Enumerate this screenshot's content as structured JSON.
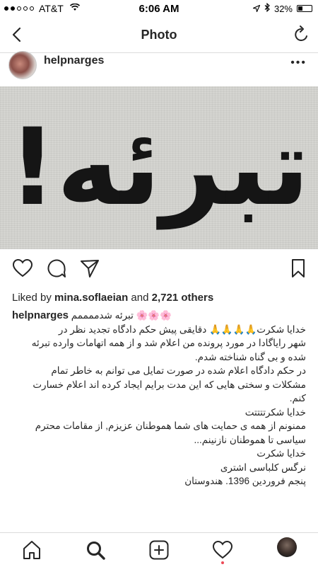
{
  "status_bar": {
    "carrier": "AT&T",
    "time": "6:06 AM",
    "battery": "32%",
    "battery_level": 0.32,
    "signal_bars_filled": 2,
    "signal_bars_total": 5
  },
  "nav": {
    "title": "Photo",
    "back_icon": "chevron-left-icon",
    "refresh_icon": "refresh-icon"
  },
  "post": {
    "username": "helpnarges",
    "more_label": "•••",
    "photo_text": "تبرئه!",
    "likes_prefix": "Liked by",
    "likes_user": "mina.soflaeian",
    "likes_and": "and",
    "likes_count": "2,721 others"
  },
  "caption": {
    "username": "helpnarges",
    "first_line": "تبرئه شدممممم",
    "flowers": "🌸🌸🌸",
    "lines": [
      "خدایا شکرت🙏🙏🙏🙏 دقایقی پیش حکم دادگاه تجدید نظر در",
      "شهر رایاگادا در مورد پرونده من اعلام شد و از همه اتهامات وارده تبرئه",
      "شده و بی گناه شناخته شدم.",
      "در حکم دادگاه اعلام شده در صورت تمایل می توانم به خاطر تمام",
      "مشکلات و سختی هایی که این مدت برایم ایجاد کرده اند اعلام خسارت",
      "کنم.",
      "خدایا شکرتتتتت",
      "ممنونم از همه ی حمایت های شما هموطنان عزیزم, از مقامات محترم",
      "سیاسی تا هموطنان نازنینم...",
      "خدایا شکرت",
      "نرگس کلباسی اشتری",
      "پنجم فروردین 1396. هندوستان"
    ]
  },
  "tab_bar": {
    "items": [
      "home-icon",
      "search-icon",
      "add-icon",
      "heart-icon",
      "profile-avatar"
    ]
  }
}
